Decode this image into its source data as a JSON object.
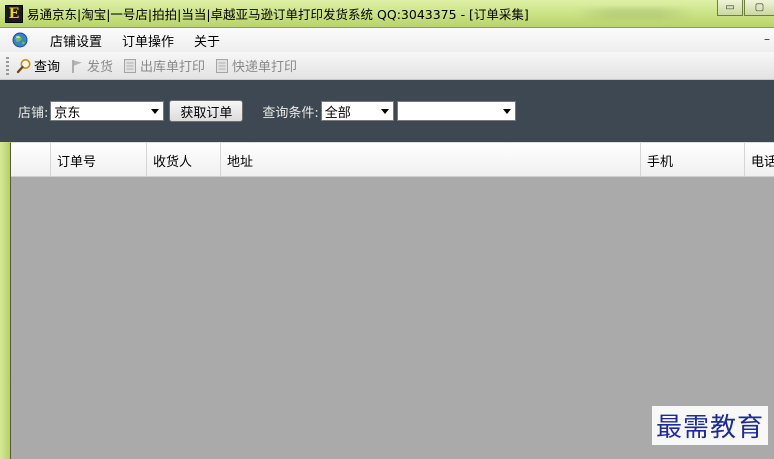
{
  "window": {
    "app_icon_glyph": "E",
    "title": "易通京东|淘宝|一号店|拍拍|当当|卓越亚马逊订单打印发货系统 QQ:3043375 - [订单采集]",
    "minimize_glyph": "▭",
    "maximize_glyph": "▢"
  },
  "menubar": {
    "items": [
      "店铺设置",
      "订单操作",
      "关于"
    ],
    "end_glyph": "–"
  },
  "toolbar": {
    "query_label": "查询",
    "ship_label": "发货",
    "outbound_print_label": "出库单打印",
    "express_print_label": "快递单打印"
  },
  "filter": {
    "shop_label": "店铺:",
    "shop_value": "京东",
    "fetch_button_label": "获取订单",
    "condition_label": "查询条件:",
    "condition_value": "全部",
    "condition_extra_value": ""
  },
  "grid": {
    "columns": [
      "",
      "订单号",
      "收货人",
      "地址",
      "手机",
      "电话"
    ]
  },
  "watermark": "最需教育",
  "colors": {
    "title_bar": "#cde58a",
    "filter_panel": "#3e4852",
    "grid_background": "#aaaaaa",
    "watermark_text": "#1c2a9c"
  },
  "icons": {
    "query": "magnifier-icon",
    "ship": "flag-icon",
    "outbound_print": "document-icon",
    "express_print": "document-icon"
  }
}
